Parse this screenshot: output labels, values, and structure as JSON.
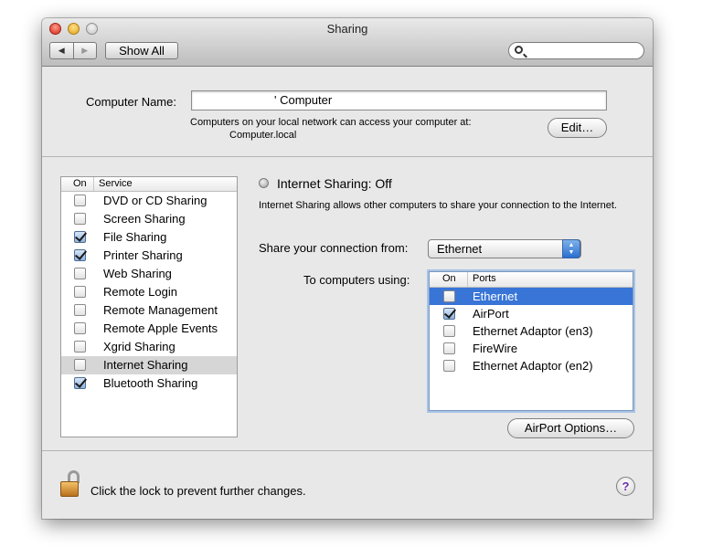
{
  "window": {
    "title": "Sharing"
  },
  "toolbar": {
    "show_all_label": "Show All",
    "back_glyph": "◀",
    "forward_glyph": "▶",
    "search_placeholder": ""
  },
  "computer": {
    "name_label": "Computer Name:",
    "name_value": "' Computer",
    "access_text": "Computers on your local network can access your computer at:",
    "address": "Computer.local",
    "edit_label": "Edit…"
  },
  "services": {
    "header_on": "On",
    "header_service": "Service",
    "items": [
      {
        "label": "DVD or CD Sharing",
        "on": false
      },
      {
        "label": "Screen Sharing",
        "on": false
      },
      {
        "label": "File Sharing",
        "on": true
      },
      {
        "label": "Printer Sharing",
        "on": true
      },
      {
        "label": "Web Sharing",
        "on": false
      },
      {
        "label": "Remote Login",
        "on": false
      },
      {
        "label": "Remote Management",
        "on": false
      },
      {
        "label": "Remote Apple Events",
        "on": false
      },
      {
        "label": "Xgrid Sharing",
        "on": false
      },
      {
        "label": "Internet Sharing",
        "on": false,
        "selected": true
      },
      {
        "label": "Bluetooth Sharing",
        "on": true
      }
    ]
  },
  "internet_sharing": {
    "status": "Internet Sharing: Off",
    "description": "Internet Sharing allows other computers to share your connection to the Internet.",
    "share_from_label": "Share your connection from:",
    "share_from_value": "Ethernet",
    "to_computers_label": "To computers using:",
    "ports_header_on": "On",
    "ports_header_ports": "Ports",
    "ports": [
      {
        "label": "Ethernet",
        "on": false,
        "selected": true
      },
      {
        "label": "AirPort",
        "on": true
      },
      {
        "label": "Ethernet Adaptor (en3)",
        "on": false
      },
      {
        "label": "FireWire",
        "on": false
      },
      {
        "label": "Ethernet Adaptor (en2)",
        "on": false
      }
    ],
    "airport_options_label": "AirPort Options…"
  },
  "footer": {
    "lock_text": "Click the lock to prevent further changes.",
    "help_glyph": "?"
  },
  "colors": {
    "selection_blue": "#3875d7",
    "selected_gray": "#d6d6d6",
    "window_bg": "#e8e8e8"
  }
}
